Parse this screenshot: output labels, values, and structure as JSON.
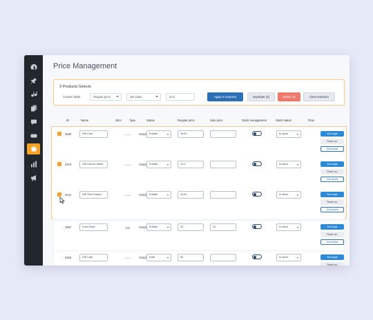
{
  "page": {
    "title": "Price Management"
  },
  "sidebar": {
    "items": [
      {
        "icon": "dashboard-icon"
      },
      {
        "icon": "pin-icon"
      },
      {
        "icon": "media-icon"
      },
      {
        "icon": "pages-icon"
      },
      {
        "icon": "comments-icon"
      },
      {
        "icon": "woo-icon"
      },
      {
        "icon": "products-icon",
        "active": true
      },
      {
        "icon": "analytics-icon"
      },
      {
        "icon": "marketing-icon"
      }
    ]
  },
  "bulk": {
    "selected_label": "3 Products Selects",
    "field_select": "Custom fields",
    "price_select": "Regular price",
    "action_select": "Set value",
    "value_input": "10.2",
    "apply_label": "Apply to selected",
    "duplicate_label": "Duplicate (3)",
    "delete_label": "Delete (3)",
    "clear_label": "Clear selection"
  },
  "columns": [
    "ID",
    "Name",
    "SKU",
    "Type",
    "Status",
    "Regular price",
    "Sale price",
    "Stock management",
    "Stock status",
    "Flow"
  ],
  "row_buttons": {
    "image": "Set Image",
    "image_alt": "Set image",
    "reset": "Reset var.",
    "edit": "Edit details"
  },
  "rows": [
    {
      "id": "2580",
      "name": "Gift Card",
      "sku": "——",
      "type": "Simple",
      "status": "Publish",
      "regular": "15.00",
      "sale": "",
      "stock_status": "In stock"
    },
    {
      "id": "2578",
      "name": "Gift Cart for Sable",
      "sku": "——",
      "type": "Simple",
      "status": "Publish",
      "regular": "12.0",
      "sale": "",
      "stock_status": "In stock"
    },
    {
      "id": "2541",
      "name": "Gift This Product",
      "sku": "——",
      "type": "Simple",
      "status": "Publish",
      "regular": "24.00",
      "sale": "",
      "stock_status": "In stock"
    },
    {
      "id": "2557",
      "name": "Food Drive",
      "sku": "130",
      "type": "Simple",
      "status": "Publish",
      "regular": "20",
      "sale": "10",
      "stock_status": "In stock"
    },
    {
      "id": "2553",
      "name": "Gift Card",
      "sku": "——",
      "type": "Simple",
      "status": "Draft",
      "regular": "50",
      "sale": "",
      "stock_status": "In stock"
    }
  ]
}
